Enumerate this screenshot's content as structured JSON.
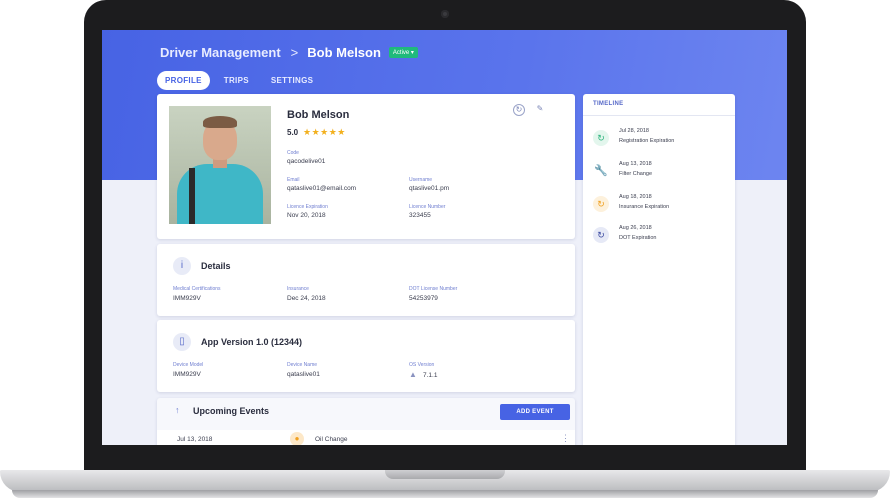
{
  "header": {
    "section": "Driver Management",
    "separator": ">",
    "driver_name": "Bob Melson",
    "status_badge": "Active ▾"
  },
  "tabs": [
    {
      "label": "PROFILE",
      "active": true
    },
    {
      "label": "TRIPS",
      "active": false
    },
    {
      "label": "SETTINGS",
      "active": false
    }
  ],
  "profile": {
    "name": "Bob Melson",
    "rating": "5.0",
    "stars": "★★★★★",
    "code_label": "Code",
    "code": "qacodelive01",
    "email_label": "Email",
    "email": "qataslive01@email.com",
    "username_label": "Username",
    "username": "qtaslive01.pm",
    "license_exp_label": "Licence Expiration",
    "license_exp": "Nov 20, 2018",
    "license_num_label": "Licence Number",
    "license_num": "323455",
    "icons": {
      "history": "history-icon",
      "edit": "pencil-icon",
      "photo": "driver-photo"
    }
  },
  "details": {
    "title": "Details",
    "fields": [
      {
        "label": "Medical Certifications",
        "value": "IMM929V"
      },
      {
        "label": "Insurance",
        "value": "Dec 24, 2018"
      },
      {
        "label": "DOT License Number",
        "value": "54253979"
      }
    ]
  },
  "app": {
    "title": "App Version 1.0 (12344)",
    "fields": [
      {
        "label": "Device Model",
        "value": "IMM929V"
      },
      {
        "label": "Device Name",
        "value": "qataslive01"
      },
      {
        "label": "OS Version",
        "value": "7.1.1"
      }
    ]
  },
  "events": {
    "title": "Upcoming Events",
    "add_button": "ADD EVENT",
    "rows": [
      {
        "date": "Jul 13, 2018",
        "name": "Oil Change"
      }
    ]
  },
  "timeline": {
    "title": "TIMELINE",
    "items": [
      {
        "date": "Jul 28, 2018",
        "text": "Registration Expiration",
        "icon": "refresh-icon",
        "color": "#2db37d",
        "bg": "#e3f6ed"
      },
      {
        "date": "Aug 13, 2018",
        "text": "Filter Change",
        "icon": "wrench-icon",
        "color": "#3b5bdb",
        "bg": "#ffffff"
      },
      {
        "date": "Aug 18, 2018",
        "text": "Insurance Expiration",
        "icon": "refresh-icon",
        "color": "#f0a020",
        "bg": "#fdf1dc"
      },
      {
        "date": "Aug 26, 2018",
        "text": "DOT Expiration",
        "icon": "refresh-icon",
        "color": "#3b4aa0",
        "bg": "#e6e9f6"
      }
    ]
  },
  "colors": {
    "accent": "#4763e4",
    "active_badge": "#1fba7c",
    "star": "#f2b01e"
  }
}
